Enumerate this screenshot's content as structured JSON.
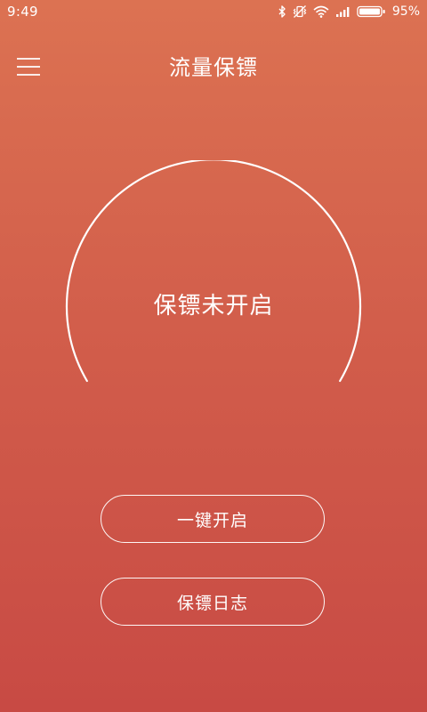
{
  "status_bar": {
    "time": "9:49",
    "battery": "95%",
    "icons": [
      "bluetooth-icon",
      "vibrate-icon",
      "wifi-icon",
      "signal-icon",
      "battery-icon"
    ]
  },
  "app_bar": {
    "title": "流量保镖",
    "menu_icon": "hamburger-menu-icon"
  },
  "gauge": {
    "status_text": "保镖未开启"
  },
  "buttons": {
    "start": "一键开启",
    "log": "保镖日志"
  },
  "colors": {
    "background_top": "#dc7252",
    "background_bottom": "#c84a44",
    "foreground": "#ffffff"
  }
}
